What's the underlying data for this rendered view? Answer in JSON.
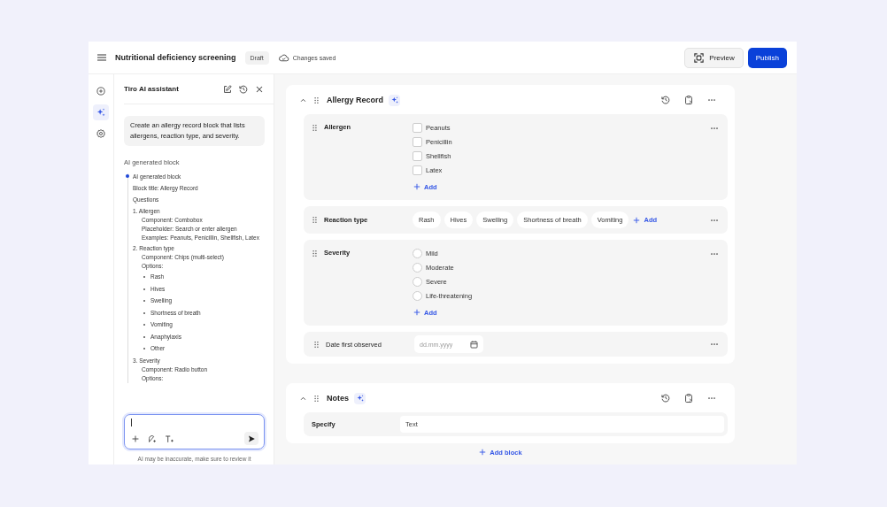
{
  "topbar": {
    "title": "Nutritional deficiency screening",
    "status_badge": "Draft",
    "save_status": "Changes saved",
    "buttons": [
      {
        "label": "Preview",
        "kind": "secondary"
      },
      {
        "label": "Publish",
        "kind": "primary"
      }
    ]
  },
  "rail": [
    {
      "kind": "add",
      "selected": false
    },
    {
      "kind": "ai",
      "selected": true
    },
    {
      "kind": "settings",
      "selected": false
    }
  ],
  "assistant": {
    "title": "Tiro AI assistant",
    "user_message": "Create an allergy record block that lists allergens, reaction type, and severity.",
    "response_heading": "AI generated block",
    "generated": {
      "title": "AI generated block",
      "lines": [
        "Block title: Allergy Record",
        "Questions"
      ],
      "questions": [
        {
          "number": "1.",
          "title": "Allergen",
          "details": [
            "Component: Combobox",
            "Placeholder: Search or enter allergen",
            "Examples: Peanuts, Penicillin, Shellfish, Latex"
          ]
        },
        {
          "number": "2.",
          "title": "Reaction type",
          "details": [
            "Component: Chips (multi-select)",
            "Options:"
          ],
          "options": [
            "Rash",
            "Hives",
            "Swelling",
            "Shortness of breath",
            "Vomiting",
            "Anaphylaxis",
            "Other"
          ]
        },
        {
          "number": "3.",
          "title": "Severity",
          "details": [
            "Component: Radio button",
            "Options:"
          ]
        }
      ]
    },
    "disclaimer": "AI may be inaccurate, make sure to review it"
  },
  "blocks": [
    {
      "title": "Allergy Record",
      "ai": true,
      "expanded": true,
      "questions": [
        {
          "kind": "checkbox",
          "label": "Allergen",
          "draggable": true,
          "options": [
            {
              "label": "Peanuts",
              "checked": false
            },
            {
              "label": "Penicillin",
              "checked": false
            },
            {
              "label": "Shellfish",
              "checked": false
            },
            {
              "label": "Latex",
              "checked": false
            }
          ],
          "add": "Add"
        },
        {
          "kind": "chips",
          "label": "Reaction type",
          "draggable": true,
          "options": [
            {
              "label": "Rash",
              "selected": false
            },
            {
              "label": "Hives",
              "selected": false
            },
            {
              "label": "Swelling",
              "selected": false
            },
            {
              "label": "Shortness of breath",
              "selected": false
            },
            {
              "label": "Vomiting",
              "selected": false
            }
          ],
          "add": "Add"
        },
        {
          "kind": "radio",
          "label": "Severity",
          "draggable": true,
          "options": [
            {
              "label": "Mild",
              "selected": false
            },
            {
              "label": "Moderate",
              "selected": false
            },
            {
              "label": "Severe",
              "selected": false
            },
            {
              "label": "Life-threatening",
              "selected": false
            }
          ],
          "add": "Add"
        },
        {
          "kind": "date",
          "label": "Date first observed",
          "draggable": true,
          "placeholder": "dd.mm.yyyy"
        }
      ]
    },
    {
      "title": "Notes",
      "ai": true,
      "expanded": true,
      "questions": [
        {
          "kind": "text",
          "label": "Specify",
          "draggable": false,
          "placeholder": "Text"
        }
      ]
    }
  ],
  "add_block": "Add block"
}
